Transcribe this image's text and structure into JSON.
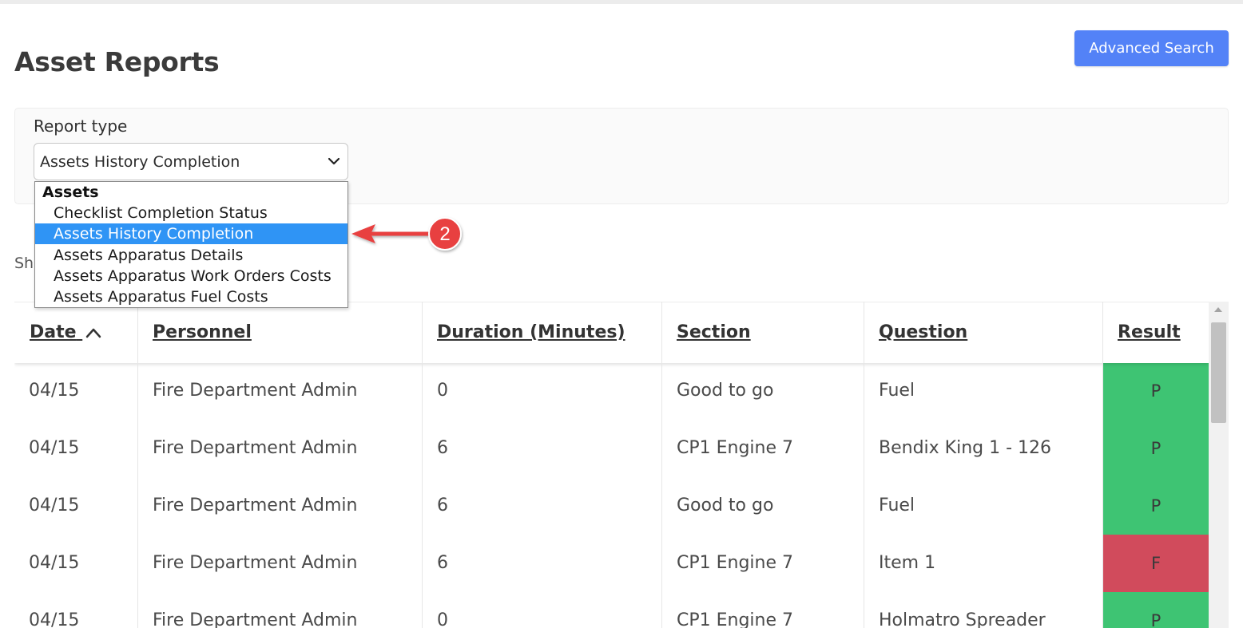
{
  "page": {
    "title": "Asset Reports",
    "advanced_search_label": "Advanced Search",
    "accent_color": "#5382f7"
  },
  "filters": {
    "report_type_label": "Report type",
    "selected_value": "Assets History Completion",
    "dropdown": {
      "group_label": "Assets",
      "options": [
        "Checklist Completion Status",
        "Assets History Completion",
        "Assets Apparatus Details",
        "Assets Apparatus Work Orders Costs",
        "Assets Apparatus Fuel Costs"
      ],
      "highlighted": "Assets History Completion",
      "highlight_color": "#2f94f5"
    }
  },
  "annotation": {
    "step_number": "2",
    "color": "#e8413f"
  },
  "show_entries_partial": "Sho",
  "table": {
    "columns": [
      "Date",
      "Personnel",
      "Duration (Minutes)",
      "Section",
      "Question",
      "Result"
    ],
    "sort_icon": "chevron-up-icon",
    "rows": [
      {
        "date": "04/15",
        "personnel": "Fire Department Admin",
        "duration": "0",
        "section": "Good to go",
        "question": "Fuel",
        "result": "P"
      },
      {
        "date": "04/15",
        "personnel": "Fire Department Admin",
        "duration": "6",
        "section": "CP1 Engine 7",
        "question": "Bendix King 1 - 126",
        "result": "P"
      },
      {
        "date": "04/15",
        "personnel": "Fire Department Admin",
        "duration": "6",
        "section": "Good to go",
        "question": "Fuel",
        "result": "P"
      },
      {
        "date": "04/15",
        "personnel": "Fire Department Admin",
        "duration": "6",
        "section": "CP1 Engine 7",
        "question": "Item 1",
        "result": "F"
      },
      {
        "date": "04/15",
        "personnel": "Fire Department Admin",
        "duration": "0",
        "section": "CP1 Engine 7",
        "question": "Holmatro Spreader",
        "result": "P"
      }
    ],
    "result_colors": {
      "P": "#3ec473",
      "F": "#d14b5c"
    }
  }
}
